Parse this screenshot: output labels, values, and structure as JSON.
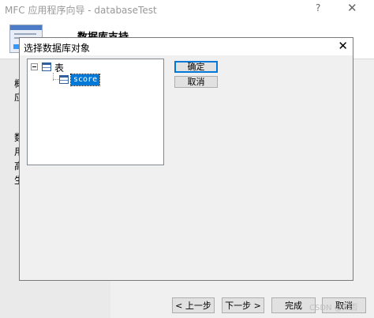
{
  "wizard": {
    "title": "MFC 应用程序向导 - databaseTest",
    "help_glyph": "?",
    "close_glyph": "✕",
    "page_title": "数据库支持",
    "nav_items": [
      "概",
      "应",
      "数",
      "用",
      "高",
      "生"
    ],
    "buttons": {
      "back": "< 上一步",
      "next": "下一步 >",
      "finish": "完成",
      "cancel": "取消"
    }
  },
  "dialog": {
    "title": "选择数据库对象",
    "close_glyph": "✕",
    "tree": {
      "expander": "⊟",
      "root_label": "表",
      "children": [
        "score"
      ]
    },
    "ok_label": "确定",
    "cancel_label": "取消"
  },
  "watermark": "CSDN @知否"
}
